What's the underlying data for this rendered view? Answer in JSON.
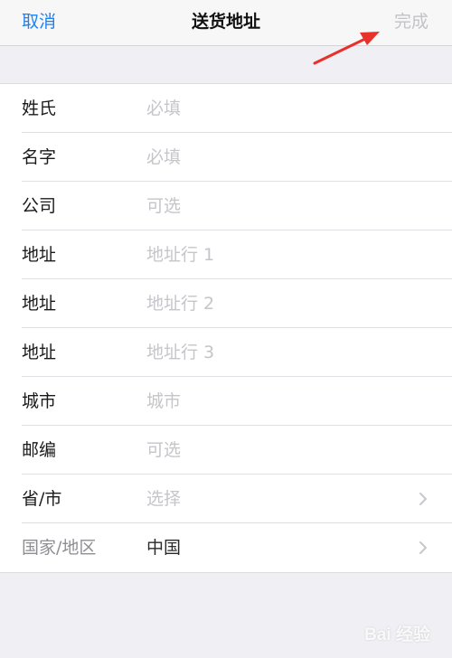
{
  "navbar": {
    "cancel": "取消",
    "title": "送货地址",
    "done": "完成"
  },
  "rows": [
    {
      "label": "姓氏",
      "placeholder": "必填"
    },
    {
      "label": "名字",
      "placeholder": "必填"
    },
    {
      "label": "公司",
      "placeholder": "可选"
    },
    {
      "label": "地址",
      "placeholder": "地址行 1"
    },
    {
      "label": "地址",
      "placeholder": "地址行 2"
    },
    {
      "label": "地址",
      "placeholder": "地址行 3"
    },
    {
      "label": "城市",
      "placeholder": "城市"
    },
    {
      "label": "邮编",
      "placeholder": "可选"
    },
    {
      "label": "省/市",
      "placeholder": "选择",
      "icon": "chevron-right-icon"
    },
    {
      "label": "国家/地区",
      "value": "中国",
      "icon": "chevron-right-icon"
    }
  ],
  "watermark": "Bai 经验",
  "colors": {
    "accent": "#1a82f7",
    "placeholder": "#c5c5ca",
    "background": "#efeff4",
    "annotation": "#e8312a"
  }
}
